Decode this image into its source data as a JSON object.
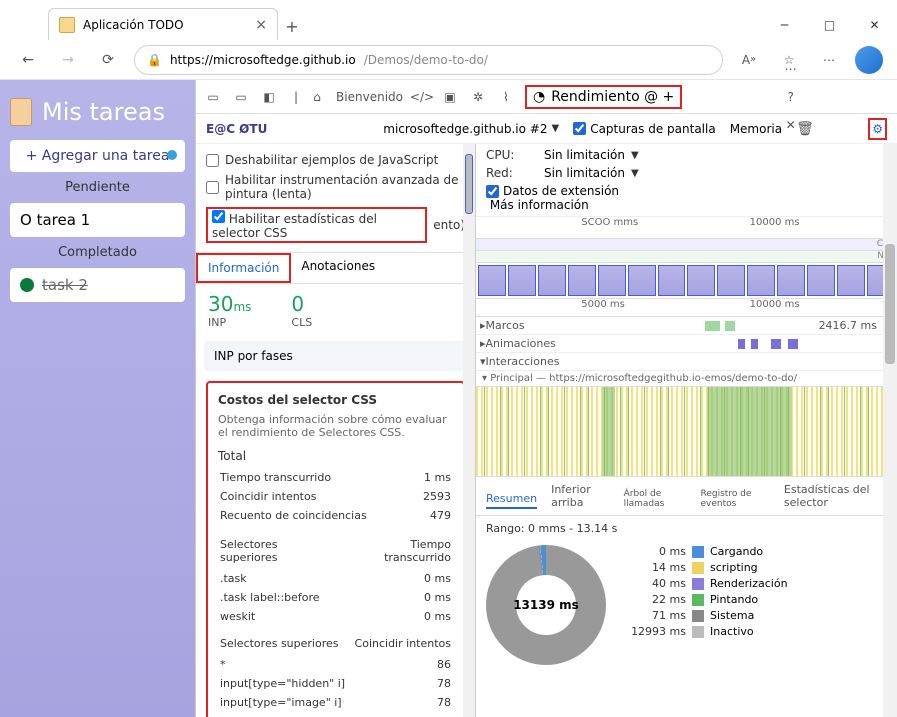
{
  "browser": {
    "tab_title": "Aplicación TODO",
    "url_domain": "https://microsoftedge.github.io",
    "url_path": "/Demos/demo-to-do/"
  },
  "app": {
    "title": "Mis tareas",
    "add_btn": "+ Agregar una tarea",
    "pending": "Pendiente",
    "completed": "Completado",
    "task1": "O tarea 1",
    "task2": "task 2"
  },
  "dt": {
    "welcome": "Bienvenido",
    "perf_tab": "Rendimiento @ +",
    "rec_label": "E@C ØTU",
    "origin": "microsoftedge.github.io #2",
    "screenshots": "Capturas de pantalla",
    "memory": "Memoria",
    "opt_disable_js": "Deshabilitar ejemplos de JavaScript",
    "opt_adv_paint": "Habilitar instrumentación avanzada de pintura (lenta)",
    "opt_css_stats": "Habilitar estadísticas del selector CSS",
    "opt_css_stats_suffix": "ento)",
    "cpu_lbl": "CPU:",
    "cpu_val": "Sin limitación",
    "net_lbl": "Red:",
    "net_val": "Sin limitación",
    "ext_data": "Datos de extensión",
    "more_info": "Más información",
    "tab_info": "Información",
    "tab_anno": "Anotaciones",
    "inp_val": "30",
    "inp_unit": "ms",
    "inp_lbl": "INP",
    "cls_val": "0",
    "cls_lbl": "CLS",
    "inp_phase": "INP por fases"
  },
  "card": {
    "title": "Costos del selector CSS",
    "sub": "Obtenga información sobre cómo evaluar el rendimiento de Selectores CSS.",
    "total": "Total",
    "rows1": [
      [
        "Tiempo transcurrido",
        "1 ms"
      ],
      [
        "Coincidir intentos",
        "2593"
      ],
      [
        "Recuento de coincidencias",
        "479"
      ]
    ],
    "h1": "Selectores superiores",
    "h1r": "Tiempo transcurrido",
    "rows2": [
      [
        ".task",
        "0 ms"
      ],
      [
        ".task label::before",
        "0 ms"
      ],
      [
        "weskit",
        "0 ms"
      ]
    ],
    "h2": "Selectores superiores",
    "h2r": "Coincidir intentos",
    "rows3": [
      [
        "*",
        "86"
      ],
      [
        "input[type=\"hidden\" i]",
        "78"
      ],
      [
        "input[type=\"image\" i]",
        "78"
      ]
    ]
  },
  "timeline": {
    "ruler1a": "SCOO mms",
    "ruler1b": "10000 ms",
    "cpu": "CPU",
    "net": "NET",
    "ruler2a": "5000 ms",
    "ruler2b": "10000 ms",
    "frames": "Marcos",
    "frames_ms": "2416.7 ms",
    "anim": "Animaciones",
    "inter": "Interacciones",
    "main": "Principal — https://microsoftedgegithub.io-emos/demo-to-do/"
  },
  "bottom": {
    "tabs": [
      "Resumen",
      "Inferior arriba",
      "Árbol de llamadas",
      "Registro de eventos",
      "Estadísticas del selector"
    ],
    "range": "Rango: 0 mms - 13.14 s",
    "center": "13139 ms",
    "legend": [
      [
        "0 ms",
        "#4a90d9",
        "Cargando"
      ],
      [
        "14 ms",
        "#f0d060",
        "scripting"
      ],
      [
        "40 ms",
        "#8a7cd8",
        "Renderización"
      ],
      [
        "22 ms",
        "#5cb85c",
        "Pintando"
      ],
      [
        "71 ms",
        "#888",
        "Sistema"
      ],
      [
        "12993 ms",
        "#bbb",
        "Inactivo"
      ]
    ]
  }
}
